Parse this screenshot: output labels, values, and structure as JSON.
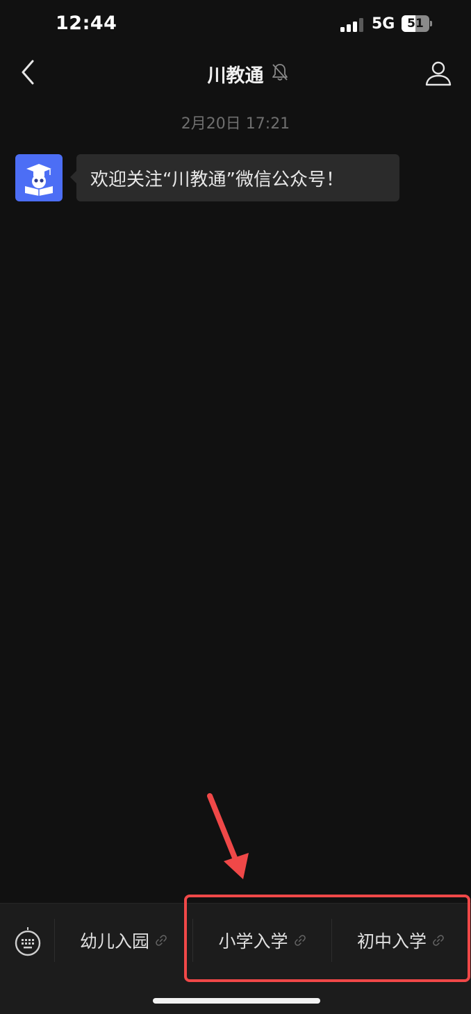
{
  "status_bar": {
    "time": "12:44",
    "network": "5G",
    "battery_level": "51",
    "battery_percent": 51,
    "signal_bars_active": 3,
    "signal_bars_total": 4
  },
  "nav": {
    "title": "川教通",
    "back_icon": "chevron-left-icon",
    "mute_icon": "bell-muted-icon",
    "profile_icon": "person-icon"
  },
  "chat": {
    "timestamp": "2月20日 17:21",
    "messages": [
      {
        "sender_icon": "graduate-book-avatar-icon",
        "text": "欢迎关注“川教通”微信公众号！"
      }
    ]
  },
  "menu": {
    "keyboard_icon": "keyboard-icon",
    "items": [
      {
        "label": "幼儿入园",
        "icon": "link-icon"
      },
      {
        "label": "小学入学",
        "icon": "link-icon"
      },
      {
        "label": "初中入学",
        "icon": "link-icon"
      }
    ]
  },
  "annotation": {
    "highlight_color": "#f04848",
    "arrow_color": "#f04848"
  },
  "colors": {
    "background": "#111111",
    "menu_background": "#1c1c1c",
    "bubble": "#2b2b2b",
    "avatar": "#4c6ef5"
  }
}
